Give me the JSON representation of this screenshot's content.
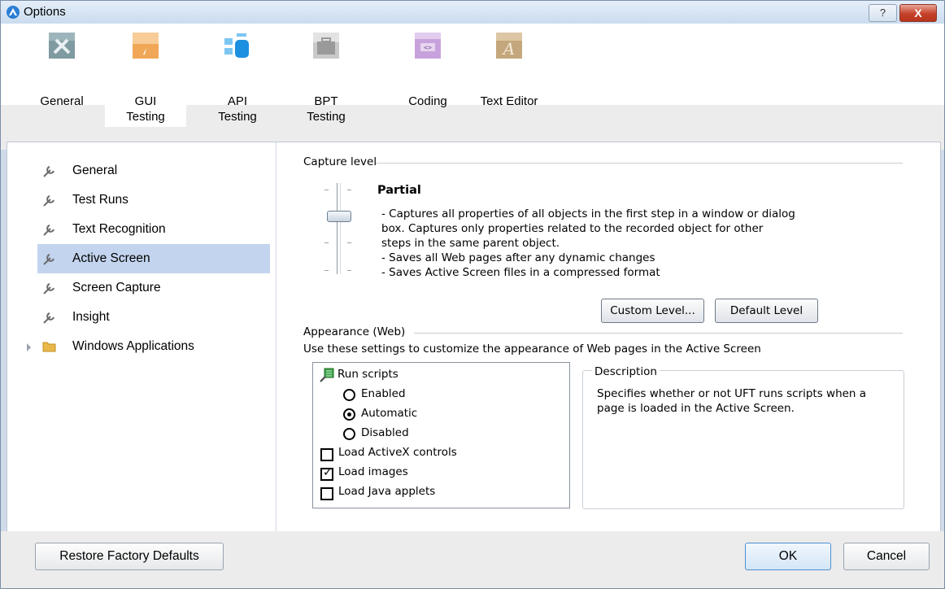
{
  "window": {
    "title": "Options",
    "help_label": "?",
    "close_label": "X",
    "app_icon": "uft-logo-icon"
  },
  "tabs": [
    {
      "label": "General",
      "icon": "tools-icon",
      "selected": false
    },
    {
      "label": "GUI\nTesting",
      "icon": "gui-testing-icon",
      "selected": true
    },
    {
      "label": "API\nTesting",
      "icon": "api-testing-icon",
      "selected": false
    },
    {
      "label": "BPT\nTesting",
      "icon": "bpt-briefcase-icon",
      "selected": false
    },
    {
      "label": "Coding",
      "icon": "coding-icon",
      "selected": false
    },
    {
      "label": "Text Editor",
      "icon": "text-editor-icon",
      "selected": false
    }
  ],
  "sidebar": {
    "items": [
      {
        "label": "General",
        "icon": "wrench-icon",
        "selected": false
      },
      {
        "label": "Test Runs",
        "icon": "wrench-icon",
        "selected": false
      },
      {
        "label": "Text Recognition",
        "icon": "wrench-icon",
        "selected": false
      },
      {
        "label": "Active Screen",
        "icon": "wrench-icon",
        "selected": true
      },
      {
        "label": "Screen Capture",
        "icon": "wrench-icon",
        "selected": false
      },
      {
        "label": "Insight",
        "icon": "wrench-icon",
        "selected": false
      },
      {
        "label": "Windows Applications",
        "icon": "folder-icon",
        "selected": false,
        "expandable": true
      }
    ]
  },
  "capture": {
    "section_title": "Capture level",
    "level_name": "Partial",
    "description_lines": [
      "- Captures all properties of all objects in the first step in a window or dialog",
      "box.  Captures only properties related to the recorded object for other",
      "steps in the same parent object.",
      "- Saves all Web pages after any dynamic changes",
      "- Saves Active Screen files in a compressed format"
    ],
    "custom_level_button": "Custom Level...",
    "default_level_button": "Default Level"
  },
  "appearance": {
    "section_title": "Appearance (Web)",
    "intro": "Use these settings to customize the appearance of Web pages in the Active Screen",
    "run_scripts_label": "Run scripts",
    "radios": [
      {
        "label": "Enabled",
        "checked": false
      },
      {
        "label": "Automatic",
        "checked": true
      },
      {
        "label": "Disabled",
        "checked": false
      }
    ],
    "checkboxes": [
      {
        "label": "Load ActiveX controls",
        "checked": false
      },
      {
        "label": "Load images",
        "checked": true
      },
      {
        "label": "Load Java applets",
        "checked": false
      }
    ],
    "description_title": "Description",
    "description_lines": [
      "Specifies whether or not UFT runs scripts when a",
      "page is loaded in the Active Screen."
    ]
  },
  "footer": {
    "restore_button": "Restore Factory Defaults",
    "ok_button": "OK",
    "cancel_button": "Cancel"
  },
  "colors": {
    "selection": "#c3d4ee",
    "title_gradient_top": "#e4eef9",
    "close_red": "#c5422a"
  }
}
